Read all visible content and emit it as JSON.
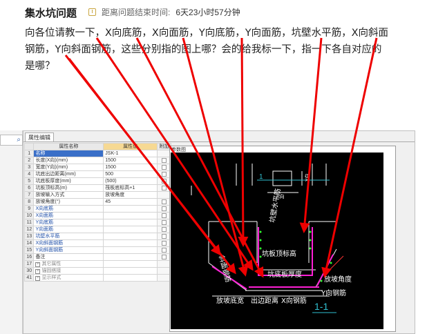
{
  "question": {
    "title": "集水坑问题",
    "timer_label": "距离问题结束时间:",
    "timer_value": "6天23小时57分钟",
    "lines": [
      "向各位请教一下，X向底筋，X向面筋，Y向底筋，Y向面筋，坑壁水平筋，X向斜面",
      "钢筋，Y向斜面钢筋，这些分别指的图上哪？会的给我标一下，指一下各自对应的",
      "是哪？"
    ]
  },
  "left_strip": {
    "search_icon": "search-icon"
  },
  "panel": {
    "tab": "属性编辑",
    "headers": {
      "name": "属性名称",
      "value": "属性值",
      "extra": "附加"
    },
    "rows": [
      {
        "no": "1",
        "name": "名称",
        "value": "JSK-1",
        "style": "selected",
        "check": false
      },
      {
        "no": "2",
        "name": "长度(X向)(mm)",
        "value": "1500",
        "style": "normal",
        "check": true
      },
      {
        "no": "3",
        "name": "宽度(Y向)(mm)",
        "value": "1500",
        "style": "normal",
        "check": true
      },
      {
        "no": "4",
        "name": "坑底出边距离(mm)",
        "value": "500",
        "style": "normal",
        "check": true
      },
      {
        "no": "5",
        "name": "坑底板厚度(mm)",
        "value": "(500)",
        "style": "normal",
        "check": true
      },
      {
        "no": "6",
        "name": "坑板顶标高(m)",
        "value": "筏板底标高+1",
        "style": "normal",
        "check": true
      },
      {
        "no": "7",
        "name": "放坡输入方式",
        "value": "放坡角度",
        "style": "normal",
        "check": false
      },
      {
        "no": "8",
        "name": "放坡角度(°)",
        "value": "45",
        "style": "normal",
        "check": true
      },
      {
        "no": "9",
        "name": "X向底筋",
        "value": "",
        "style": "blue",
        "check": true
      },
      {
        "no": "10",
        "name": "X向面筋",
        "value": "",
        "style": "blue",
        "check": true
      },
      {
        "no": "11",
        "name": "Y向底筋",
        "value": "",
        "style": "blue",
        "check": true
      },
      {
        "no": "12",
        "name": "Y向面筋",
        "value": "",
        "style": "blue",
        "check": true
      },
      {
        "no": "13",
        "name": "坑壁水平筋",
        "value": "",
        "style": "blue",
        "check": true
      },
      {
        "no": "14",
        "name": "X向斜面钢筋",
        "value": "",
        "style": "blue",
        "check": true
      },
      {
        "no": "15",
        "name": "Y向斜面钢筋",
        "value": "",
        "style": "blue",
        "check": true
      },
      {
        "no": "16",
        "name": "备注",
        "value": "",
        "style": "normal",
        "check": true
      },
      {
        "no": "17",
        "name": "其它属性",
        "value": "",
        "style": "group",
        "check": false
      },
      {
        "no": "30",
        "name": "锚固搭接",
        "value": "",
        "style": "group",
        "check": false
      },
      {
        "no": "41",
        "name": "显示样式",
        "value": "",
        "style": "group",
        "check": false
      }
    ],
    "view_title": "参数图"
  },
  "drawing": {
    "label_1_top": "1",
    "dim_y": "Y向",
    "dim_x": "X向",
    "wall_rebar": "坑壁水平筋",
    "top_elev": "坑板顶标高",
    "slope_rebar": "斜面钢筋",
    "bottom_thk": "坑底板厚度",
    "slope_angle": "放坡角度",
    "y_rebar": "Y向钢筋",
    "slope_width": "放坡底宽",
    "edge_dist": "出边距离",
    "x_rebar": "X向钢筋",
    "section": "1-1",
    "colors": {
      "rebar": "#ff1fd6",
      "dots": "#33ff33",
      "lines": "#ffffff",
      "accent": "#ff3333",
      "cyan": "#30c0d0"
    }
  },
  "annotation_color": "#ee0000"
}
